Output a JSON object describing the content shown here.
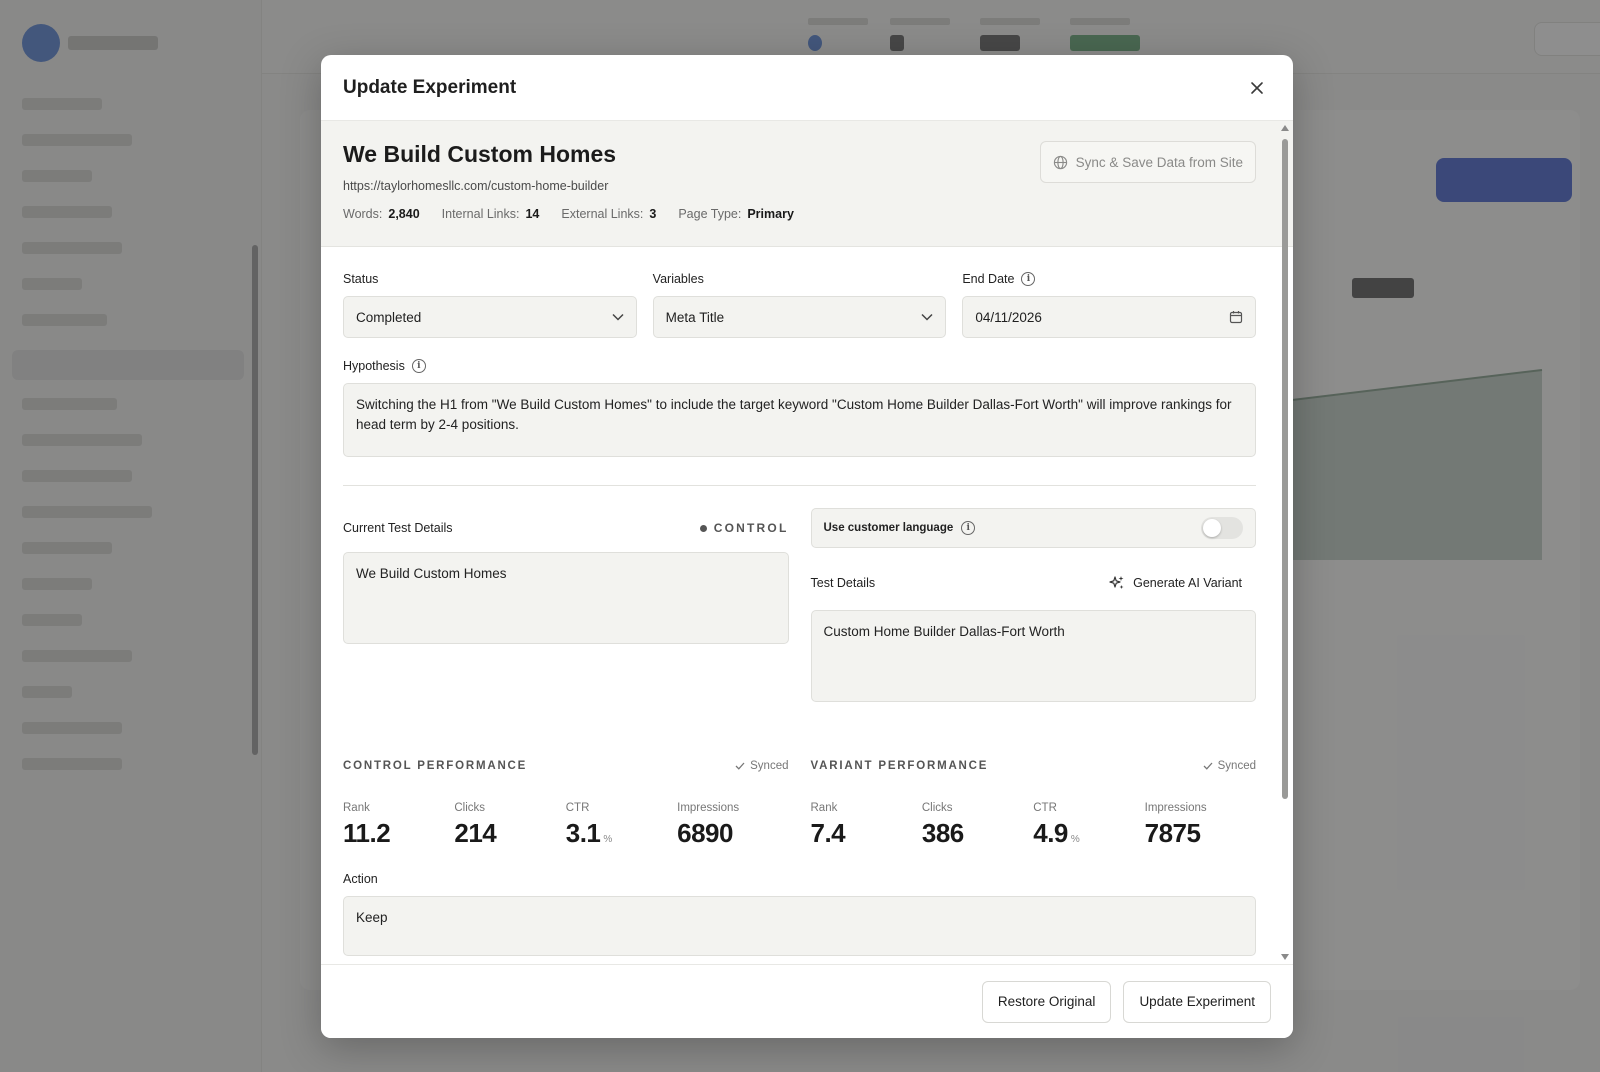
{
  "modal": {
    "title": "Update Experiment"
  },
  "page": {
    "title": "We Build Custom Homes",
    "url": "https://taylorhomesllc.com/custom-home-builder",
    "stats": [
      {
        "label": "Words:",
        "value": "2,840"
      },
      {
        "label": "Internal Links:",
        "value": "14"
      },
      {
        "label": "External Links:",
        "value": "3"
      },
      {
        "label": "Page Type:",
        "value": "Primary"
      }
    ],
    "sync_label": "Sync & Save Data from Site"
  },
  "form": {
    "status_label": "Status",
    "status_value": "Completed",
    "variables_label": "Variables",
    "variables_value": "Meta Title",
    "end_date_label": "End Date",
    "end_date_value": "04/11/2026",
    "hypothesis_label": "Hypothesis",
    "hypothesis_text": "Switching the H1 from \"We Build Custom Homes\" to include the target keyword \"Custom Home Builder Dallas-Fort Worth\" will improve rankings for head term by 2-4 positions."
  },
  "control": {
    "label": "Current Test Details",
    "badge": "CONTROL",
    "text": "We Build Custom Homes"
  },
  "variant": {
    "toggle_label": "Use customer language",
    "toggle_on": false,
    "label": "Test Details",
    "generate_label": "Generate AI Variant",
    "text": "Custom Home Builder Dallas-Fort Worth"
  },
  "control_performance": {
    "title": "CONTROL PERFORMANCE",
    "synced": "Synced",
    "metrics": [
      {
        "label": "Rank",
        "value": "11.2",
        "unit": ""
      },
      {
        "label": "Clicks",
        "value": "214",
        "unit": ""
      },
      {
        "label": "CTR",
        "value": "3.1",
        "unit": "%"
      },
      {
        "label": "Impressions",
        "value": "6890",
        "unit": ""
      }
    ]
  },
  "variant_performance": {
    "title": "VARIANT PERFORMANCE",
    "synced": "Synced",
    "metrics": [
      {
        "label": "Rank",
        "value": "7.4",
        "unit": ""
      },
      {
        "label": "Clicks",
        "value": "386",
        "unit": ""
      },
      {
        "label": "CTR",
        "value": "4.9",
        "unit": "%"
      },
      {
        "label": "Impressions",
        "value": "7875",
        "unit": ""
      }
    ]
  },
  "action": {
    "label": "Action",
    "value": "Keep"
  },
  "footer": {
    "restore_label": "Restore Original",
    "update_label": "Update Experiment"
  },
  "colors": {
    "accent": "#2548c8",
    "field_bg": "#f3f3f0"
  }
}
